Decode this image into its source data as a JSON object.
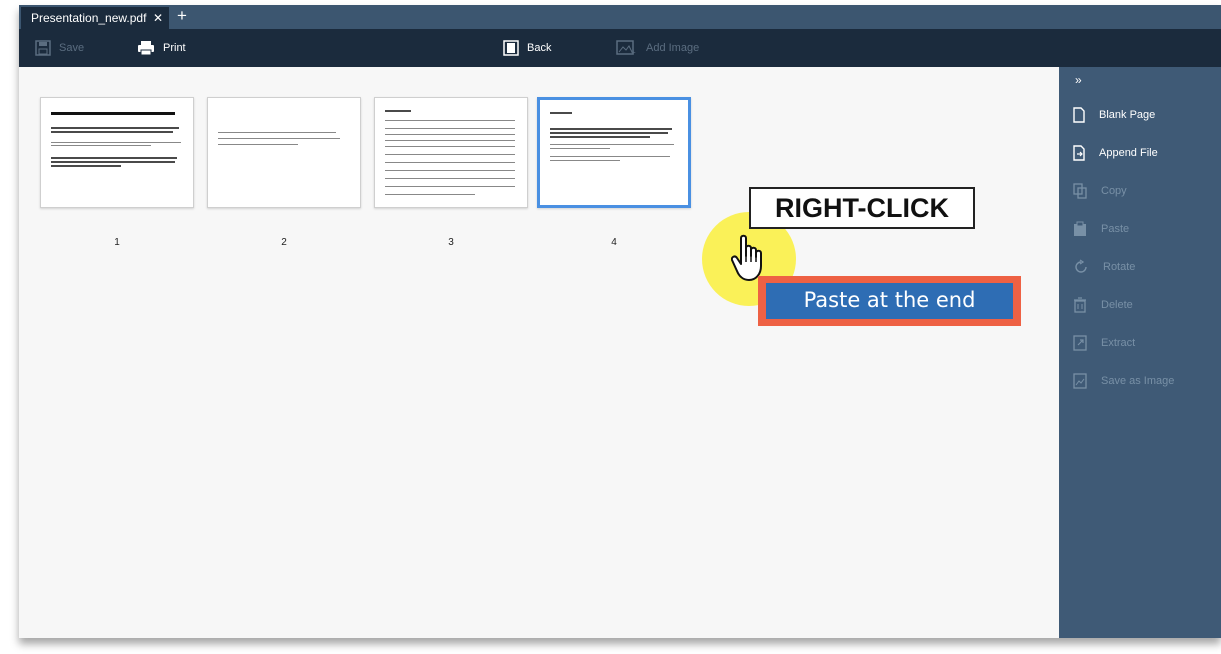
{
  "tabbar": {
    "tab_title": "Presentation_new.pdf",
    "close_symbol": "✕",
    "new_tab_symbol": "+"
  },
  "toolbar": {
    "save_label": "Save",
    "print_label": "Print",
    "back_label": "Back",
    "add_image_label": "Add Image"
  },
  "pages": [
    {
      "number": "1"
    },
    {
      "number": "2"
    },
    {
      "number": "3"
    },
    {
      "number": "4",
      "selected": true
    }
  ],
  "sidebar": {
    "collapse_symbol": "»",
    "items": [
      {
        "label": "Blank Page",
        "enabled": true,
        "icon": "blank-page-icon"
      },
      {
        "label": "Append File",
        "enabled": true,
        "icon": "append-file-icon"
      },
      {
        "label": "Copy",
        "enabled": false,
        "icon": "copy-icon"
      },
      {
        "label": "Paste",
        "enabled": false,
        "icon": "paste-icon"
      },
      {
        "label": "Rotate",
        "enabled": false,
        "icon": "rotate-icon"
      },
      {
        "label": "Delete",
        "enabled": false,
        "icon": "delete-icon"
      },
      {
        "label": "Extract",
        "enabled": false,
        "icon": "extract-icon"
      },
      {
        "label": "Save as Image",
        "enabled": false,
        "icon": "save-as-image-icon"
      }
    ]
  },
  "annotation": {
    "callout": "RIGHT-CLICK"
  },
  "context_menu": {
    "item": "Paste at the end"
  },
  "colors": {
    "tabbar": "#3c5670",
    "toolbar": "#1b2b3d",
    "sidebar": "#3f5a76",
    "selection": "#4a90e2",
    "menu_highlight": "#ee6144",
    "menu_item": "#2e6db4"
  }
}
